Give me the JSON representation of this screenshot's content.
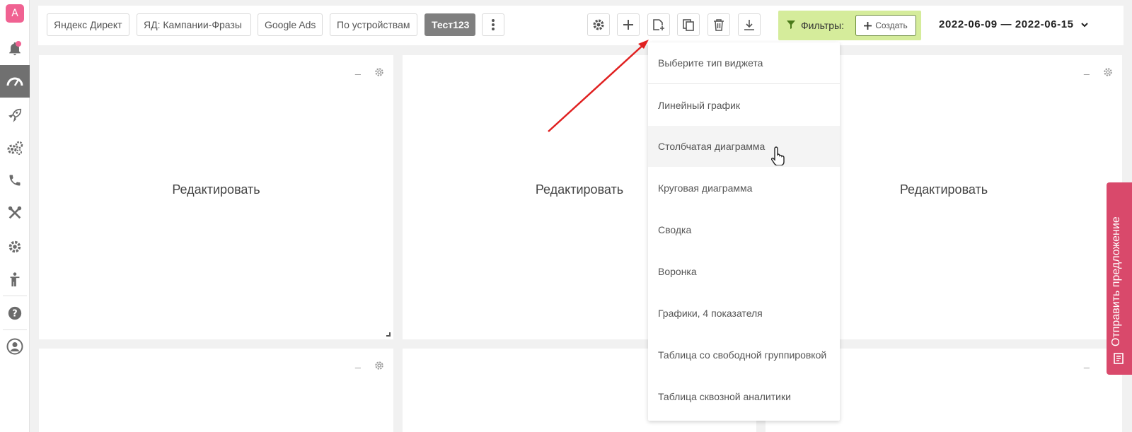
{
  "sidebar": {
    "logo_letter": "A",
    "items": [
      {
        "name": "notifications",
        "icon": "bell-icon"
      },
      {
        "name": "dashboard",
        "icon": "speedometer-icon",
        "active": true
      },
      {
        "name": "launch",
        "icon": "rocket-icon"
      },
      {
        "name": "integrations",
        "icon": "gears-icon"
      },
      {
        "name": "calls",
        "icon": "phone-icon"
      },
      {
        "name": "tools",
        "icon": "tools-icon"
      },
      {
        "name": "settings",
        "icon": "gear-icon"
      },
      {
        "name": "accessibility",
        "icon": "person-icon"
      },
      {
        "name": "help",
        "icon": "question-icon"
      },
      {
        "name": "profile",
        "icon": "user-icon"
      }
    ]
  },
  "tabs": [
    {
      "label": "Яндекс Директ"
    },
    {
      "label": "ЯД: Кампании-Фразы"
    },
    {
      "label": "Google Ads"
    },
    {
      "label": "По устройствам"
    },
    {
      "label": "Тест123",
      "active": true
    }
  ],
  "toolbar": {
    "icons": [
      "more-icon",
      "settings-icon",
      "plus-icon",
      "add-widget-icon",
      "copy-icon",
      "trash-icon",
      "download-icon"
    ]
  },
  "filters": {
    "label": "Фильтры:",
    "create_label": "Создать",
    "accent_color": "#d5ec9b"
  },
  "date_range": "2022-06-09 — 2022-06-15",
  "widgets": {
    "edit_label": "Редактировать",
    "minimize_label": "_"
  },
  "widget_menu": {
    "header": "Выберите тип виджета",
    "items": [
      "Линейный график",
      "Столбчатая диаграмма",
      "Круговая диаграмма",
      "Сводка",
      "Воронка",
      "Графики, 4 показателя",
      "Таблица со свободной группировкой",
      "Таблица сквозной аналитики"
    ],
    "hovered_index": 1
  },
  "feedback": {
    "label": "Отправить предложение",
    "color": "#d9496b"
  },
  "annotation": {
    "arrow_color": "#e02020"
  }
}
